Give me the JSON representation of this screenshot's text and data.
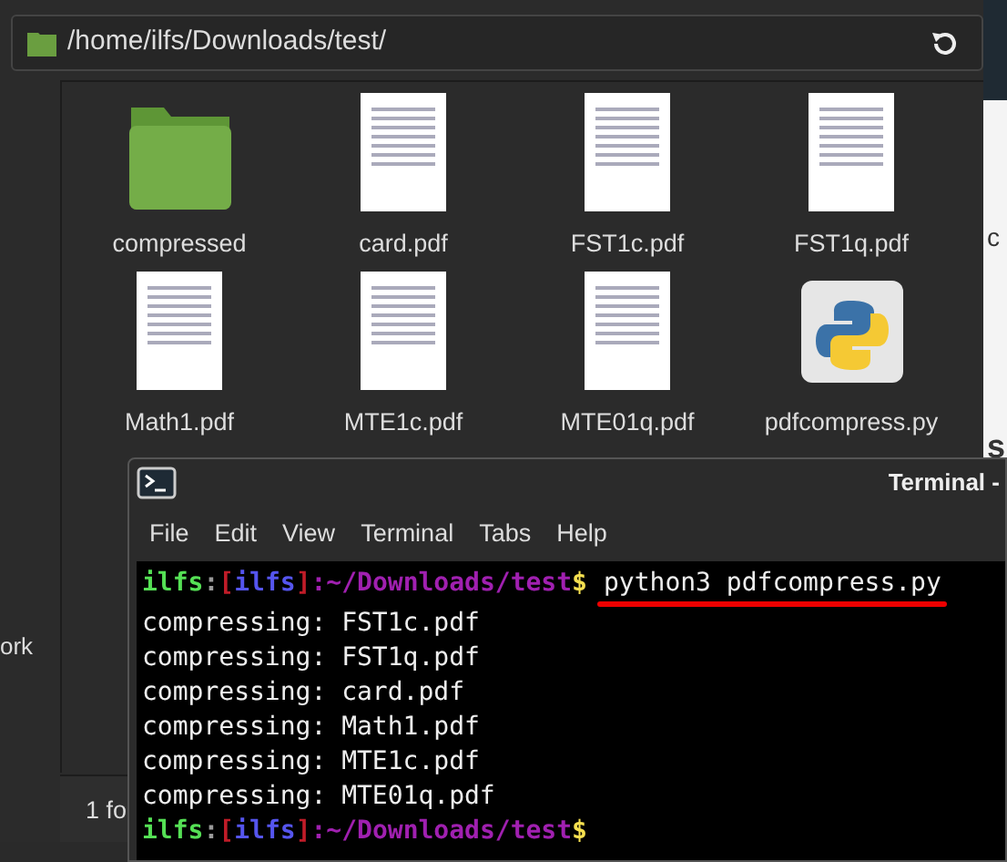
{
  "file_manager": {
    "path": "/home/ilfs/Downloads/test/",
    "items": [
      {
        "name": "compressed",
        "kind": "folder"
      },
      {
        "name": "card.pdf",
        "kind": "pdf"
      },
      {
        "name": "FST1c.pdf",
        "kind": "pdf"
      },
      {
        "name": "FST1q.pdf",
        "kind": "pdf"
      },
      {
        "name": "Math1.pdf",
        "kind": "pdf"
      },
      {
        "name": "MTE1c.pdf",
        "kind": "pdf"
      },
      {
        "name": "MTE01q.pdf",
        "kind": "pdf"
      },
      {
        "name": "pdfcompress.py",
        "kind": "python"
      }
    ],
    "sidebar_text": "ork",
    "status_text": "1 fo"
  },
  "background_window": {
    "texts": [
      "c",
      "s"
    ]
  },
  "terminal": {
    "title": "Terminal -",
    "menu": [
      "File",
      "Edit",
      "View",
      "Terminal",
      "Tabs",
      "Help"
    ],
    "lines": [
      {
        "kind": "prompt",
        "segments": [
          {
            "text": "ilfs",
            "color": "#55e055"
          },
          {
            "text": ":",
            "color": "#9a9a9a"
          },
          {
            "text": "[",
            "color": "#c01c28"
          },
          {
            "text": "ilfs",
            "color": "#5555ee"
          },
          {
            "text": "]",
            "color": "#c01c28"
          },
          {
            "text": ":~/Downloads/test",
            "color": "#a020b0"
          },
          {
            "text": "$",
            "color": "#f5e050"
          }
        ],
        "command": "python3 pdfcompress.py",
        "underlined": true
      },
      {
        "kind": "output",
        "text": "compressing: FST1c.pdf"
      },
      {
        "kind": "output",
        "text": "compressing: FST1q.pdf"
      },
      {
        "kind": "output",
        "text": "compressing: card.pdf"
      },
      {
        "kind": "output",
        "text": "compressing: Math1.pdf"
      },
      {
        "kind": "output",
        "text": "compressing: MTE1c.pdf"
      },
      {
        "kind": "output",
        "text": "compressing: MTE01q.pdf"
      },
      {
        "kind": "prompt",
        "segments": [
          {
            "text": "ilfs",
            "color": "#55e055"
          },
          {
            "text": ":",
            "color": "#9a9a9a"
          },
          {
            "text": "[",
            "color": "#c01c28"
          },
          {
            "text": "ilfs",
            "color": "#5555ee"
          },
          {
            "text": "]",
            "color": "#c01c28"
          },
          {
            "text": ":~/Downloads/test",
            "color": "#a020b0"
          },
          {
            "text": "$",
            "color": "#f5e050"
          }
        ]
      }
    ]
  }
}
